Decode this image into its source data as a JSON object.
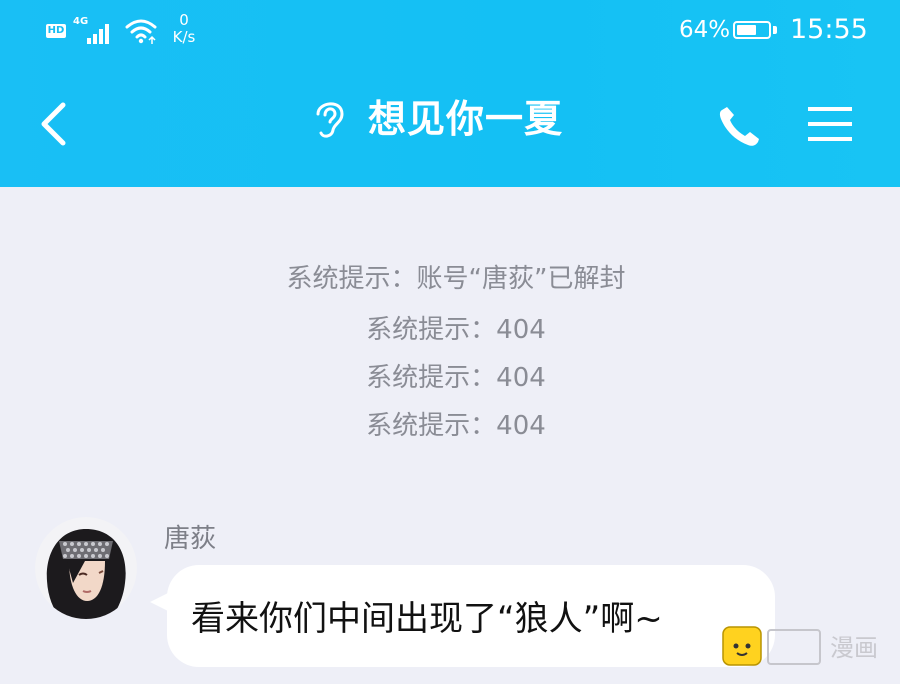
{
  "status_bar": {
    "hd": "HD",
    "network": "4G",
    "net_speed_value": "0",
    "net_speed_unit": "K/s",
    "battery_percent": "64%",
    "battery_level": 0.64,
    "time": "15:55"
  },
  "header": {
    "title": "想见你一夏",
    "background_color": "#19bff5"
  },
  "icons": {
    "back": "back-chevron-icon",
    "ear": "ear-icon",
    "phone": "phone-icon",
    "menu": "hamburger-menu-icon"
  },
  "system_messages": [
    "系统提示：账号“唐荻”已解封",
    "系统提示：404",
    "系统提示：404",
    "系统提示：404"
  ],
  "messages": [
    {
      "sender": "唐荻",
      "text": "看来你们中间出现了“狼人”啊~"
    }
  ],
  "watermark": {
    "text": "漫画"
  }
}
